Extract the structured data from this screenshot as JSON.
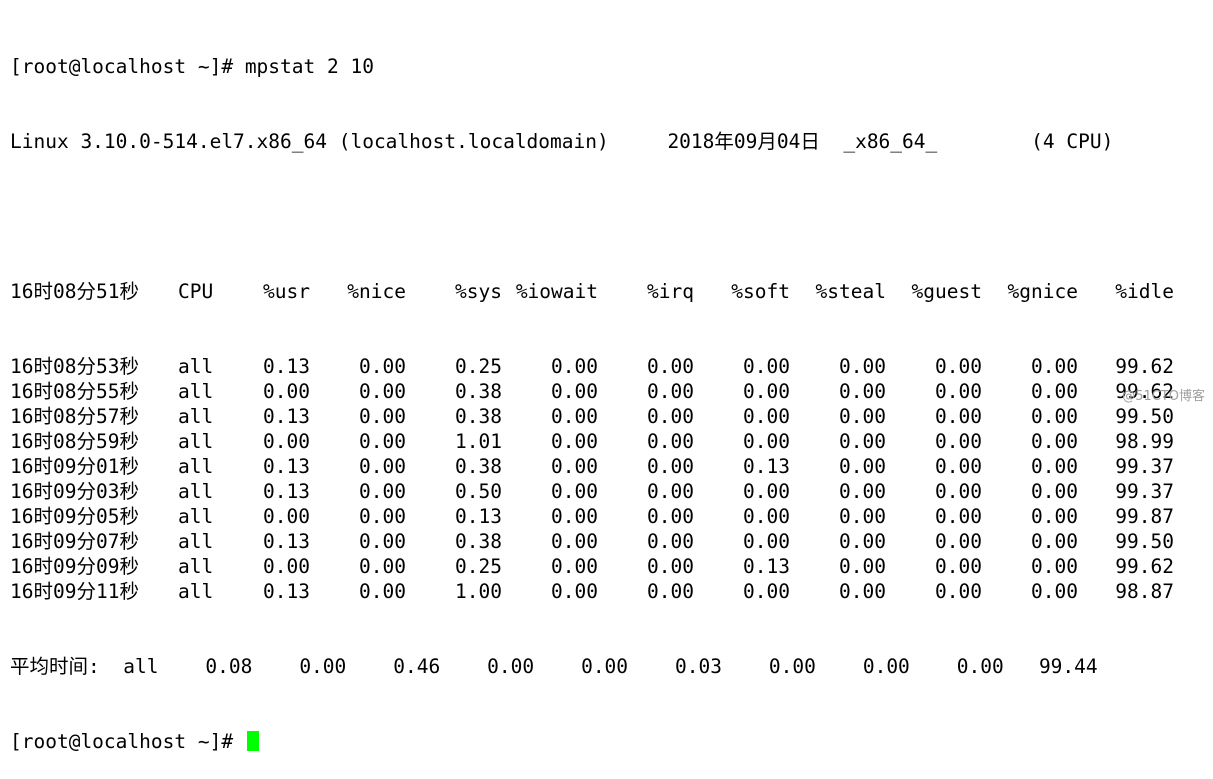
{
  "command_line": {
    "prompt": "[root@localhost ~]#",
    "command": "mpstat 2 10"
  },
  "system_info": "Linux 3.10.0-514.el7.x86_64 (localhost.localdomain)     2018年09月04日  _x86_64_        (4 CPU)",
  "header": [
    "16时08分51秒",
    "CPU",
    "%usr",
    "%nice",
    "%sys",
    "%iowait",
    "%irq",
    "%soft",
    "%steal",
    "%guest",
    "%gnice",
    "%idle"
  ],
  "rows": [
    [
      "16时08分53秒",
      "all",
      "0.13",
      "0.00",
      "0.25",
      "0.00",
      "0.00",
      "0.00",
      "0.00",
      "0.00",
      "0.00",
      "99.62"
    ],
    [
      "16时08分55秒",
      "all",
      "0.00",
      "0.00",
      "0.38",
      "0.00",
      "0.00",
      "0.00",
      "0.00",
      "0.00",
      "0.00",
      "99.62"
    ],
    [
      "16时08分57秒",
      "all",
      "0.13",
      "0.00",
      "0.38",
      "0.00",
      "0.00",
      "0.00",
      "0.00",
      "0.00",
      "0.00",
      "99.50"
    ],
    [
      "16时08分59秒",
      "all",
      "0.00",
      "0.00",
      "1.01",
      "0.00",
      "0.00",
      "0.00",
      "0.00",
      "0.00",
      "0.00",
      "98.99"
    ],
    [
      "16时09分01秒",
      "all",
      "0.13",
      "0.00",
      "0.38",
      "0.00",
      "0.00",
      "0.13",
      "0.00",
      "0.00",
      "0.00",
      "99.37"
    ],
    [
      "16时09分03秒",
      "all",
      "0.13",
      "0.00",
      "0.50",
      "0.00",
      "0.00",
      "0.00",
      "0.00",
      "0.00",
      "0.00",
      "99.37"
    ],
    [
      "16时09分05秒",
      "all",
      "0.00",
      "0.00",
      "0.13",
      "0.00",
      "0.00",
      "0.00",
      "0.00",
      "0.00",
      "0.00",
      "99.87"
    ],
    [
      "16时09分07秒",
      "all",
      "0.13",
      "0.00",
      "0.38",
      "0.00",
      "0.00",
      "0.00",
      "0.00",
      "0.00",
      "0.00",
      "99.50"
    ],
    [
      "16时09分09秒",
      "all",
      "0.00",
      "0.00",
      "0.25",
      "0.00",
      "0.00",
      "0.13",
      "0.00",
      "0.00",
      "0.00",
      "99.62"
    ],
    [
      "16时09分11秒",
      "all",
      "0.13",
      "0.00",
      "1.00",
      "0.00",
      "0.00",
      "0.00",
      "0.00",
      "0.00",
      "0.00",
      "98.87"
    ]
  ],
  "average_row": "平均时间:  all    0.08    0.00    0.46    0.00    0.00    0.03    0.00    0.00    0.00   99.44",
  "final_prompt": "[root@localhost ~]#",
  "cursor_color": "#00ff00",
  "watermark": "@51CTO博客"
}
